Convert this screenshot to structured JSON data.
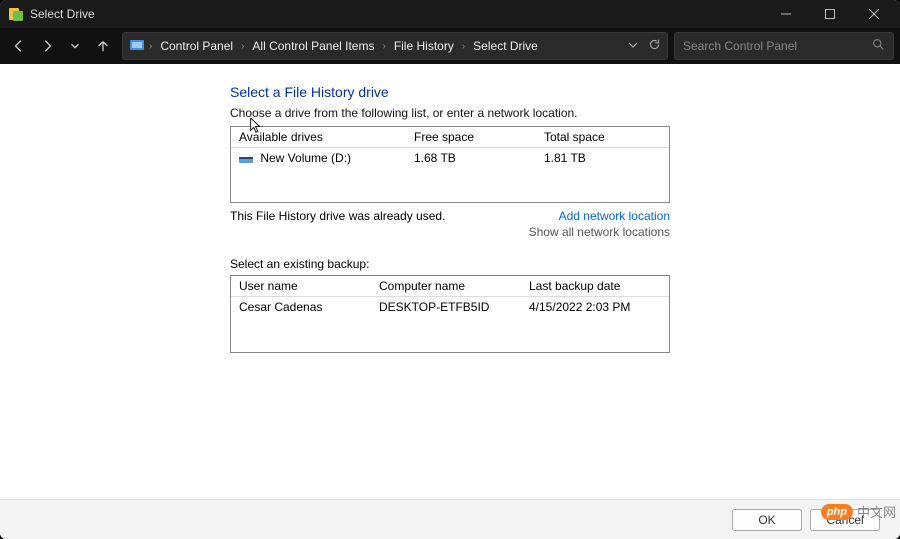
{
  "window": {
    "title": "Select Drive"
  },
  "titlebar_controls": {
    "min": "minimize",
    "max": "maximize",
    "close": "close"
  },
  "nav": {
    "breadcrumbs": [
      "Control Panel",
      "All Control Panel Items",
      "File History",
      "Select Drive"
    ],
    "search_placeholder": "Search Control Panel"
  },
  "page": {
    "heading": "Select a File History drive",
    "instruction": "Choose a drive from the following list, or enter a network location.",
    "drives": {
      "headers": {
        "name": "Available drives",
        "free": "Free space",
        "total": "Total space"
      },
      "rows": [
        {
          "name": "New Volume (D:)",
          "free": "1.68 TB",
          "total": "1.81 TB"
        }
      ]
    },
    "status": "This File History drive was already used.",
    "links": {
      "add": "Add network location",
      "show": "Show all network locations"
    },
    "backup_label": "Select an existing backup:",
    "backups": {
      "headers": {
        "user": "User name",
        "computer": "Computer name",
        "date": "Last backup date"
      },
      "rows": [
        {
          "user": "Cesar Cadenas",
          "computer": "DESKTOP-ETFB5ID",
          "date": "4/15/2022 2:03 PM"
        }
      ]
    }
  },
  "footer": {
    "ok": "OK",
    "cancel": "Cancel"
  },
  "watermark": {
    "badge": "php",
    "text": "中文网"
  }
}
